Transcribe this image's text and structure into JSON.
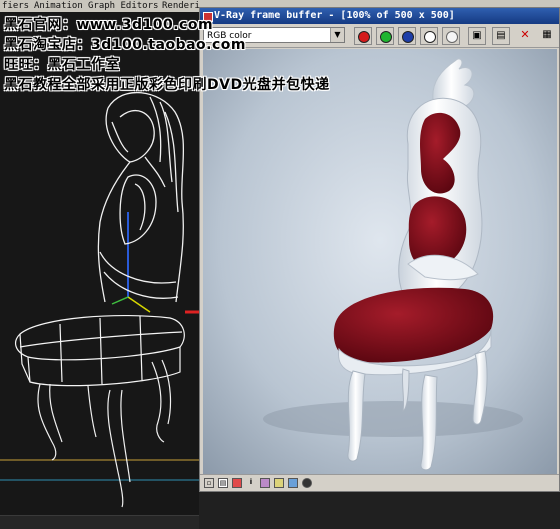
{
  "menubar": {
    "items": [
      "fiers",
      "Animation",
      "Graph Editors",
      "Renderi"
    ]
  },
  "watermark": {
    "line1": "黑石官网：www.3d100.com",
    "line2": "黑石淘宝店：3d100.taobao.com",
    "line3": "旺旺：黑石工作室",
    "line4": "黑石教程全部采用正版彩色印刷DVD光盘并包快递"
  },
  "frame_buffer": {
    "title": "V-Ray frame buffer - [100% of 500 x 500]",
    "channel_value": "RGB color",
    "toolbar_buttons": [
      "red-channel",
      "green-channel",
      "blue-channel",
      "alpha-channel",
      "mono",
      "save",
      "clear"
    ],
    "status_icons": [
      "track-mouse-icon",
      "history-icon",
      "color-icon",
      "info-icon",
      "compare-icon",
      "lut-icon",
      "curves-icon",
      "region-icon"
    ],
    "colors": {
      "title_bar": "#1c4a9a",
      "red": "#d41a1a",
      "green": "#1fb52f",
      "blue": "#1e3ea8",
      "upholstery": "#7d0f1a",
      "frame": "#eef2f7",
      "background": "#b7c3cf"
    }
  }
}
